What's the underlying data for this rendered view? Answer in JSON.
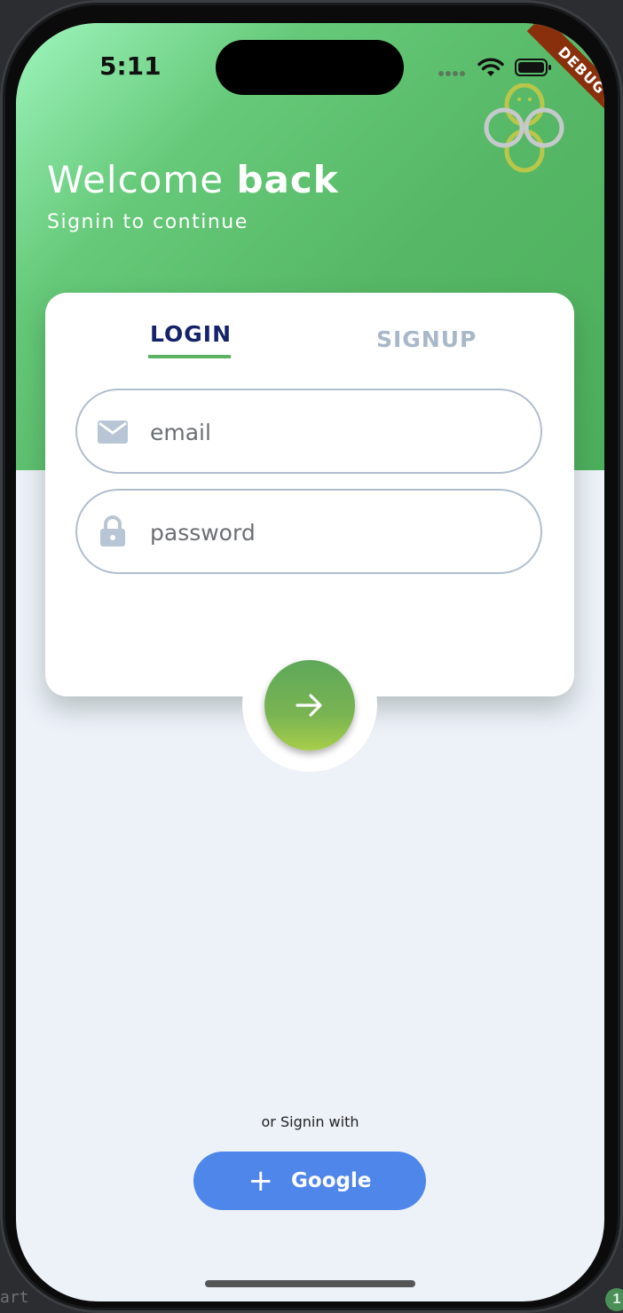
{
  "status_bar": {
    "time": "5:11"
  },
  "debug_banner": "DEBUG",
  "header": {
    "welcome_prefix": "Welcome ",
    "welcome_bold": "back",
    "subtitle": "Signin to continue"
  },
  "tabs": [
    {
      "label": "LOGIN",
      "active": true
    },
    {
      "label": "SIGNUP",
      "active": false
    }
  ],
  "form": {
    "email_placeholder": "email",
    "password_placeholder": "password"
  },
  "social": {
    "prompt": "or Signin with",
    "google_label": "Google",
    "google_icon": "plus-icon"
  },
  "editor": {
    "corner_text": "art",
    "badge_count": "1"
  },
  "colors": {
    "header_green": "#56b866",
    "tab_active": "#16236b",
    "tab_inactive": "#a8b8c9",
    "google_blue": "#4e86ea"
  }
}
